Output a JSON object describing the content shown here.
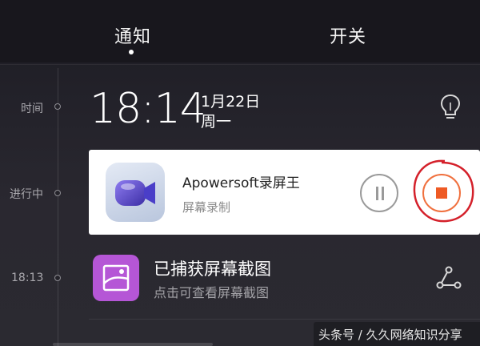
{
  "tabs": {
    "notify_label": "通知",
    "switch_label": "开关",
    "active": "通知"
  },
  "timeline": {
    "labels": [
      "时间",
      "进行中",
      "18:13"
    ]
  },
  "clock": {
    "time": "18:14",
    "date": "1月22日",
    "weekday": "周一",
    "icon": "lightbulb-icon"
  },
  "ongoing": {
    "app_name": "Apowersoft录屏王",
    "subtitle": "屏幕录制",
    "icon": "video-camera-app-icon",
    "pause_icon": "pause-icon",
    "stop_icon": "stop-icon",
    "highlight_color": "#d4202a",
    "stop_color": "#ee5a24"
  },
  "screenshot": {
    "title": "已捕获屏幕截图",
    "subtitle": "点击可查看屏幕截图",
    "icon": "image-icon",
    "action_icon": "share-icon",
    "icon_color": "#b556d6"
  },
  "watermark": {
    "text": "头条号 / 久久网络知识分享"
  }
}
